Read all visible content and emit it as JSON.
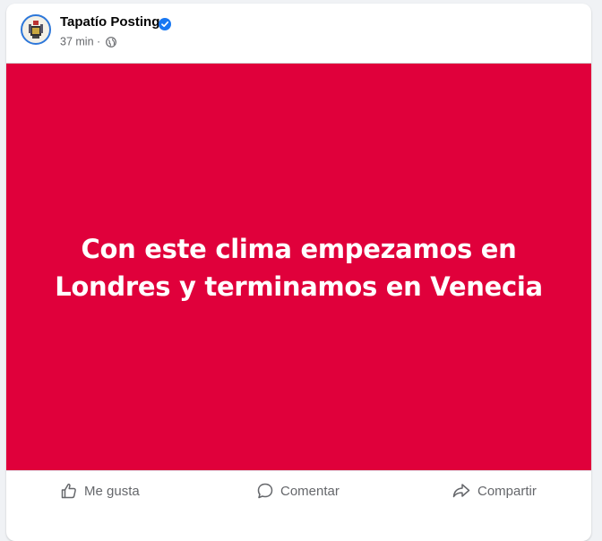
{
  "post": {
    "page_name": "Tapatío Posting",
    "timestamp": "37 min",
    "separator": "·",
    "text": "Con este clima empezamos en Londres y terminamos en Venecia",
    "background_color": "#e0003b"
  },
  "actions": {
    "like_label": "Me gusta",
    "comment_label": "Comentar",
    "share_label": "Compartir"
  },
  "icons": {
    "verified": "verified-badge-icon",
    "audience": "globe-icon",
    "like": "thumbs-up-icon",
    "comment": "speech-bubble-icon",
    "share": "share-arrow-icon"
  },
  "colors": {
    "accent": "#1877f2",
    "text_secondary": "#65676b"
  }
}
